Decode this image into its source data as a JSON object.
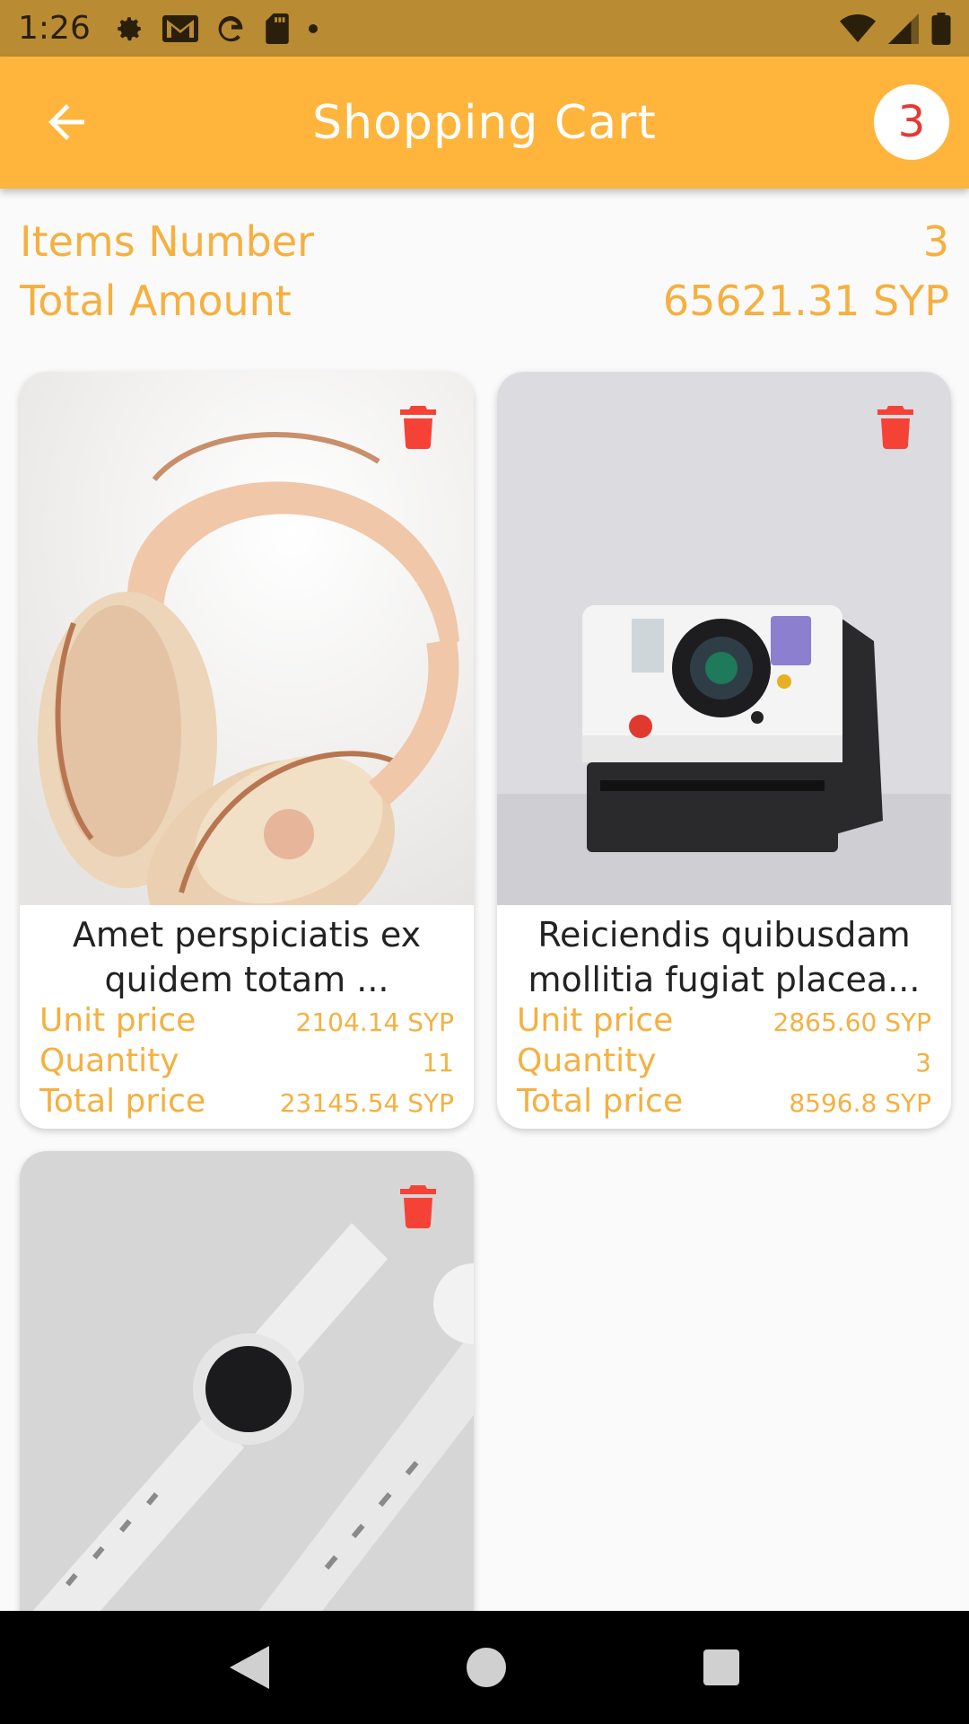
{
  "status": {
    "time": "1:26",
    "icons": [
      "settings-icon",
      "gmail-icon",
      "google-icon",
      "sd-card-icon",
      "dot-icon",
      "wifi-icon",
      "signal-icon",
      "battery-icon"
    ]
  },
  "appbar": {
    "title": "Shopping Cart",
    "badge_count": "3",
    "color": "#ffb43c"
  },
  "summary": {
    "items_label": "Items Number",
    "items_value": "3",
    "total_label": "Total Amount",
    "total_value": "65621.31 SYP"
  },
  "products": [
    {
      "title": "Amet perspiciatis ex quidem totam ...",
      "unit_label": "Unit price",
      "unit_value": "2104.14 SYP",
      "qty_label": "Quantity",
      "qty_value": "11",
      "total_label": "Total price",
      "total_value": "23145.54 SYP",
      "image": "headphones"
    },
    {
      "title": "Reiciendis quibusdam mollitia fugiat placea...",
      "unit_label": "Unit price",
      "unit_value": "2865.60 SYP",
      "qty_label": "Quantity",
      "qty_value": "3",
      "total_label": "Total price",
      "total_value": "8596.8 SYP",
      "image": "instant-camera"
    },
    {
      "image": "smartwatch"
    }
  ],
  "colors": {
    "accent": "#f5b040",
    "delete": "#f44336",
    "status_bar": "#b98b33"
  }
}
